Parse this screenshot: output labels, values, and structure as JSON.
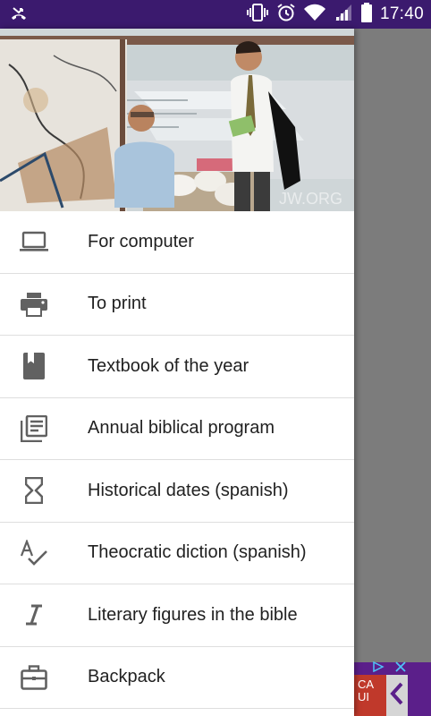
{
  "status_bar": {
    "time": "17:40",
    "icons": [
      "missed-call-icon",
      "vibrate-icon",
      "alarm-icon",
      "wifi-icon",
      "signal-icon",
      "battery-icon"
    ]
  },
  "header_image": {
    "watermark": "JW.ORG"
  },
  "menu": {
    "items": [
      {
        "label": "For computer",
        "icon": "laptop-icon"
      },
      {
        "label": "To print",
        "icon": "printer-icon"
      },
      {
        "label": "Textbook of the year",
        "icon": "book-icon"
      },
      {
        "label": "Annual biblical program",
        "icon": "library-books-icon"
      },
      {
        "label": "Historical dates (spanish)",
        "icon": "hourglass-icon"
      },
      {
        "label": "Theocratic diction (spanish)",
        "icon": "spellcheck-icon"
      },
      {
        "label": "Literary figures in the bible",
        "icon": "italic-icon"
      },
      {
        "label": "Backpack",
        "icon": "briefcase-icon"
      }
    ]
  },
  "ad": {
    "text": "CA\nUI"
  },
  "colors": {
    "status_bar": "#3b1a6e",
    "icon_gray": "#616161",
    "scrim": "#7c7c7c",
    "ad_purple": "#5b1f8a"
  }
}
